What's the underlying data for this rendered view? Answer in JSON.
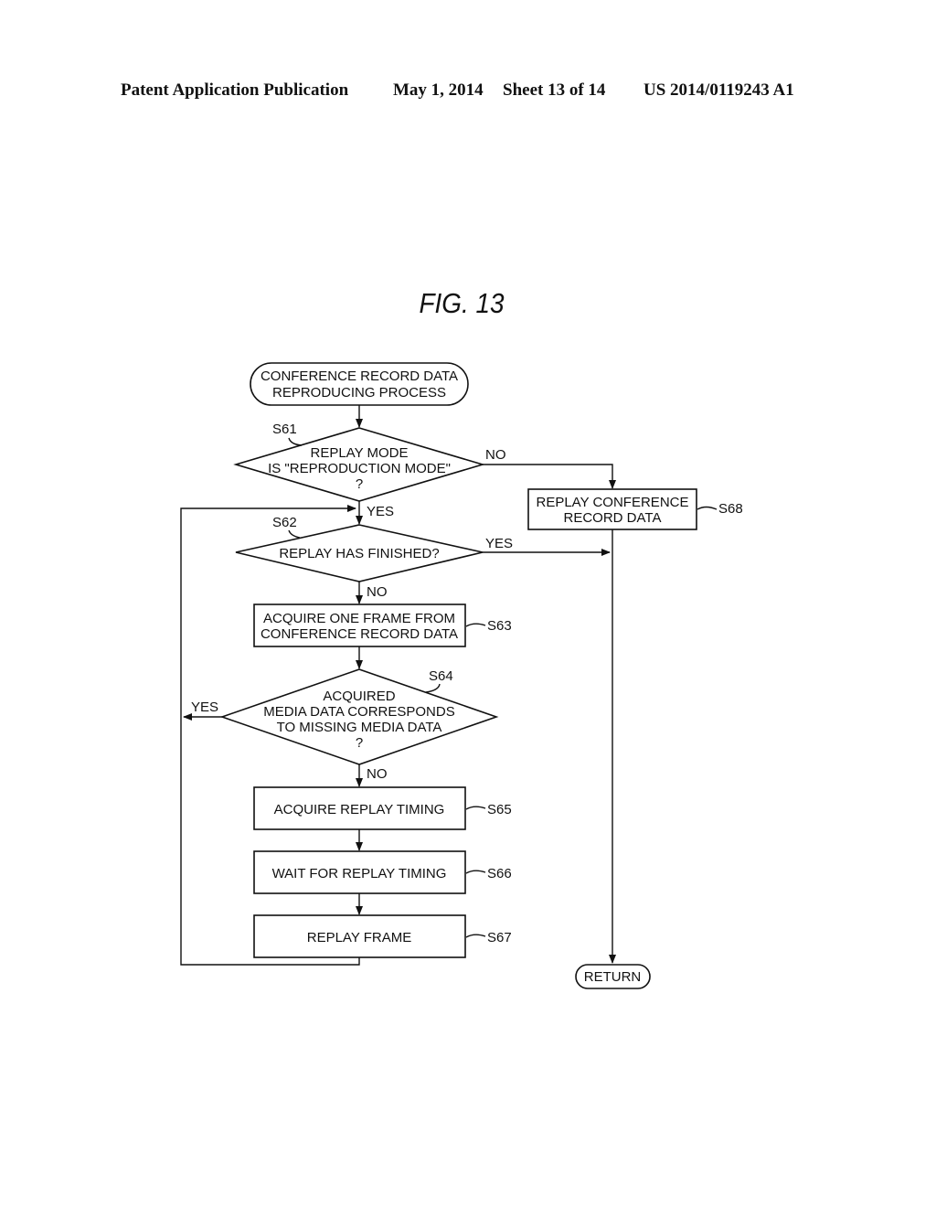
{
  "header": {
    "publication": "Patent Application Publication",
    "date": "May 1, 2014",
    "sheet": "Sheet 13 of 14",
    "number": "US 2014/0119243 A1"
  },
  "figure": {
    "title": "FIG. 13"
  },
  "flowchart": {
    "start": {
      "lines": [
        "CONFERENCE RECORD DATA",
        "REPRODUCING PROCESS"
      ]
    },
    "s61": {
      "step": "S61",
      "lines": [
        "REPLAY MODE",
        "IS \"REPRODUCTION MODE\"",
        "?"
      ],
      "yes": "YES",
      "no": "NO"
    },
    "s62": {
      "step": "S62",
      "lines": [
        "REPLAY HAS FINISHED?"
      ],
      "yes": "YES",
      "no": "NO"
    },
    "s63": {
      "step": "S63",
      "lines": [
        "ACQUIRE ONE FRAME FROM",
        "CONFERENCE RECORD DATA"
      ]
    },
    "s64": {
      "step": "S64",
      "lines": [
        "ACQUIRED",
        "MEDIA DATA CORRESPONDS",
        "TO MISSING MEDIA DATA",
        "?"
      ],
      "yes": "YES",
      "no": "NO"
    },
    "s65": {
      "step": "S65",
      "lines": [
        "ACQUIRE REPLAY TIMING"
      ]
    },
    "s66": {
      "step": "S66",
      "lines": [
        "WAIT FOR REPLAY TIMING"
      ]
    },
    "s67": {
      "step": "S67",
      "lines": [
        "REPLAY FRAME"
      ]
    },
    "s68": {
      "step": "S68",
      "lines": [
        "REPLAY CONFERENCE",
        "RECORD DATA"
      ]
    },
    "end": {
      "lines": [
        "RETURN"
      ]
    }
  }
}
